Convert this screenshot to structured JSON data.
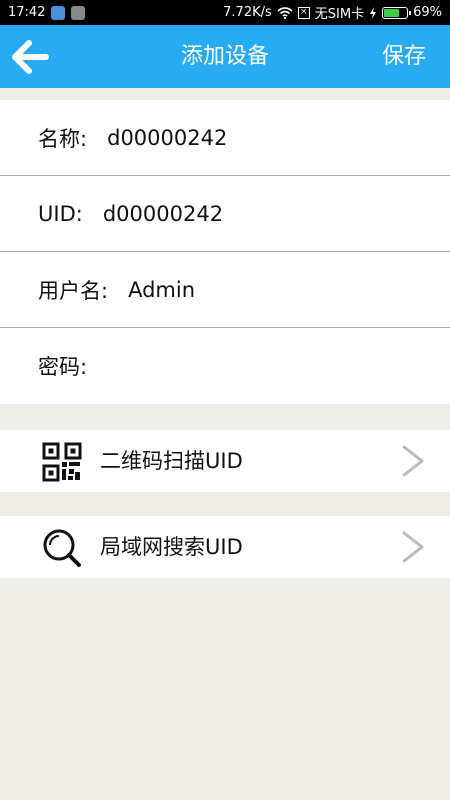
{
  "status_bar": {
    "time": "17:42",
    "speed": "7.72K/s",
    "carrier": "无SIM卡",
    "battery": "69%",
    "battery_level": 0.69
  },
  "app_bar": {
    "title": "添加设备",
    "save_label": "保存",
    "back_icon": "arrow-left-icon"
  },
  "form": {
    "name_label": "名称:   ",
    "name_value": "d00000242",
    "uid_label": "UID:   ",
    "uid_value": "d00000242",
    "user_label": "用户名:   ",
    "user_value": "Admin",
    "password_label": "密码:",
    "password_value": ""
  },
  "actions": {
    "qr_scan_label": "二维码扫描UID",
    "qr_icon": "qr-code-icon",
    "lan_search_label": "局域网搜索UID",
    "search_icon": "search-icon"
  },
  "colors": {
    "accent": "#29abf3",
    "background": "#efede8"
  }
}
